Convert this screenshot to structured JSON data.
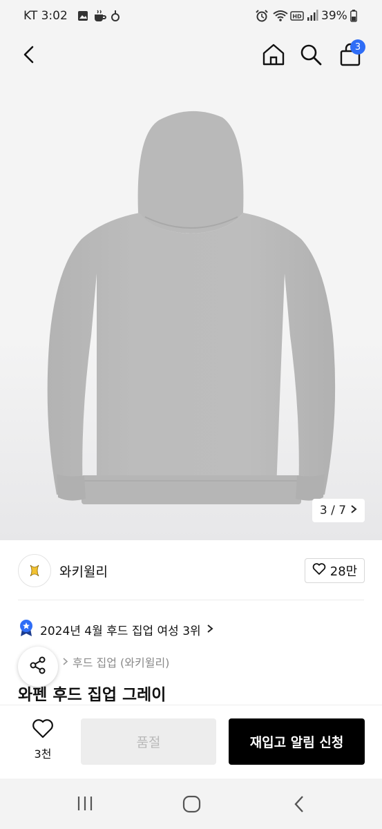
{
  "status_bar": {
    "carrier_time": "KT 3:02",
    "battery": "39%",
    "icons": [
      "gallery-icon",
      "coffee-icon",
      "app-icon",
      "alarm-icon",
      "wifi-icon",
      "hd-icon",
      "signal-icon",
      "battery-icon"
    ]
  },
  "header": {
    "cart_count": "3",
    "icons": [
      "back-arrow-icon",
      "home-icon",
      "search-icon",
      "cart-icon"
    ]
  },
  "gallery": {
    "counter": "3 / 7",
    "next_icon": "chevron-right-icon",
    "image_subject": "grey hoodie back view"
  },
  "brand": {
    "name": "와키윌리",
    "likes": "28만"
  },
  "ranking": {
    "text": "2024년 4월 후드 집업 여성 3위"
  },
  "breadcrumb": {
    "category": "후드 집업 (와키윌리)"
  },
  "product": {
    "title": "와펜 후드 집업 그레이"
  },
  "bottom_bar": {
    "wish_count": "3천",
    "soldout_label": "품절",
    "restock_label": "재입고 알림 신청"
  },
  "colors": {
    "accent": "#2f6df6",
    "primary_button": "#000000",
    "disabled_button": "#ededed"
  }
}
